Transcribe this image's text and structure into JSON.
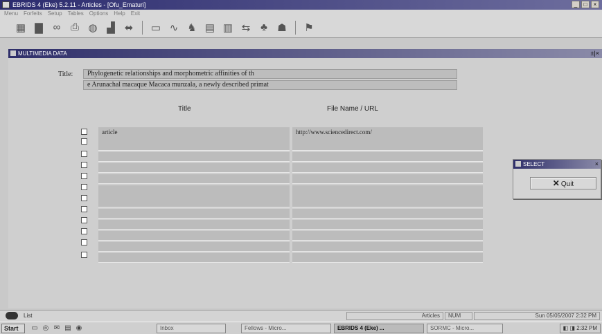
{
  "window": {
    "title": "EBRIDS 4 (Eke) 5.2.11 - Articles - [Ofu_Ematuri]",
    "controls": [
      "_",
      "□",
      "×"
    ]
  },
  "menu": [
    "Menu",
    "Forfeits",
    "Setup",
    "Tables",
    "Options",
    "Help",
    "Exit"
  ],
  "toolbar": {
    "icons": [
      "grid-icon",
      "table-icon",
      "binoculars-icon",
      "printer-icon",
      "globe-icon",
      "chart-icon",
      "arrows-icon",
      "monitor-icon",
      "graph-icon",
      "chess-icon",
      "record-icon",
      "data-icon",
      "link-icon",
      "tree-icon",
      "people-icon",
      "flag-icon"
    ]
  },
  "subwindow": {
    "title": "MULTIMEDIA DATA",
    "controls": "±|×"
  },
  "form": {
    "title_label": "Title:",
    "title_line1": "Phylogenetic relationships and morphometric affinities of th",
    "title_line2": "e Arunachal macaque Macaca munzala, a newly described primat",
    "col_title": "Title",
    "col_file": "File Name / URL",
    "rows": [
      {
        "title": "article",
        "file": "http://www.sciencedirect.com/"
      },
      {
        "title": "",
        "file": ""
      },
      {
        "title": "",
        "file": ""
      },
      {
        "title": "",
        "file": ""
      },
      {
        "title": "",
        "file": ""
      },
      {
        "title": "",
        "file": ""
      },
      {
        "title": "",
        "file": ""
      },
      {
        "title": "",
        "file": ""
      },
      {
        "title": "",
        "file": ""
      },
      {
        "title": "",
        "file": ""
      },
      {
        "title": "",
        "file": ""
      },
      {
        "title": "",
        "file": ""
      }
    ]
  },
  "select_window": {
    "title": "SELECT",
    "close": "×",
    "quit_label": "Quit"
  },
  "status": {
    "left": "List",
    "module": "Articles",
    "num": "NUM",
    "datetime": "Sun 05/05/2007 2:32 PM"
  },
  "taskbar": {
    "start": "Start",
    "items": [
      "Inbox",
      "Fellows - Micro...",
      "EBRIDS 4 (Eke) ...",
      "SORMC - Micro..."
    ],
    "clock": "2:32 PM"
  }
}
